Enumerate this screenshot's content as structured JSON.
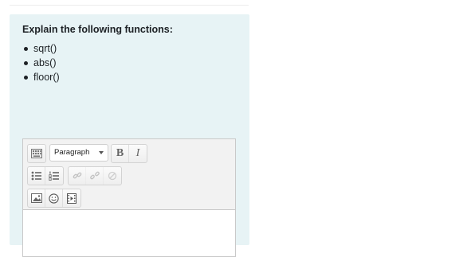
{
  "question": {
    "prompt": "Explain the following functions:",
    "functions": [
      "sqrt()",
      "abs()",
      "floor()"
    ]
  },
  "editor": {
    "format_select": "Paragraph",
    "toolbar": {
      "row1": [
        "toolbar-toggle-icon",
        "format-select",
        "bold-icon",
        "italic-icon"
      ],
      "row2": [
        "unordered-list-icon",
        "ordered-list-icon",
        "link-icon",
        "unlink-icon",
        "disabled-icon"
      ],
      "row3": [
        "image-icon",
        "emoticon-icon",
        "media-icon"
      ]
    },
    "bold_label": "B",
    "italic_label": "I",
    "content": ""
  }
}
